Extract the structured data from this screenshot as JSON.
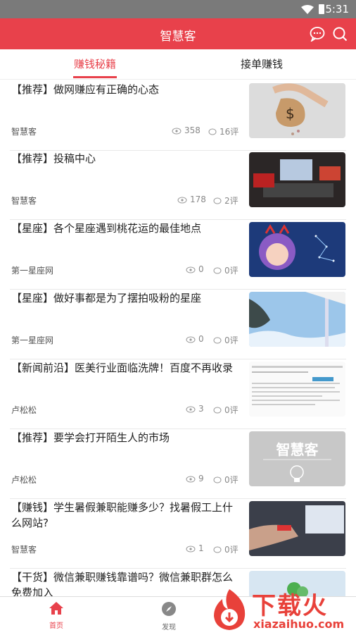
{
  "status": {
    "time": "5:31"
  },
  "app": {
    "title": "智慧客"
  },
  "tabs": [
    {
      "label": "赚钱秘籍"
    },
    {
      "label": "接单赚钱"
    }
  ],
  "articles": [
    {
      "title": "【推荐】做网赚应有正确的心态",
      "author": "智慧客",
      "views": "358",
      "comments": "16评"
    },
    {
      "title": "【推荐】投稿中心",
      "author": "智慧客",
      "views": "178",
      "comments": "2评"
    },
    {
      "title": "【星座】各个星座遇到桃花运的最佳地点",
      "author": "第一星座网",
      "views": "0",
      "comments": "0评"
    },
    {
      "title": "【星座】做好事都是为了摆拍吸粉的星座",
      "author": "第一星座网",
      "views": "0",
      "comments": "0评"
    },
    {
      "title": "【新闻前沿】医美行业面临洗牌！百度不再收录",
      "author": "卢松松",
      "views": "3",
      "comments": "0评"
    },
    {
      "title": "【推荐】要学会打开陌生人的市场",
      "author": "卢松松",
      "views": "9",
      "comments": "0评"
    },
    {
      "title": "【赚钱】学生暑假兼职能赚多少？找暑假工上什么网站?",
      "author": "智慧客",
      "views": "1",
      "comments": "0评"
    },
    {
      "title": "【干货】微信兼职赚钱靠谱吗？微信兼职群怎么免费加入",
      "author": "",
      "views": "",
      "comments": ""
    }
  ],
  "thumb_texts": {
    "brand": "智慧客"
  },
  "nav": {
    "home": "首页",
    "discover": "发现"
  },
  "watermark": {
    "line1": "下载火",
    "line2": "xiazaihuo.com"
  },
  "colors": {
    "accent": "#e8414b",
    "statusbar": "#7a7a7a"
  }
}
